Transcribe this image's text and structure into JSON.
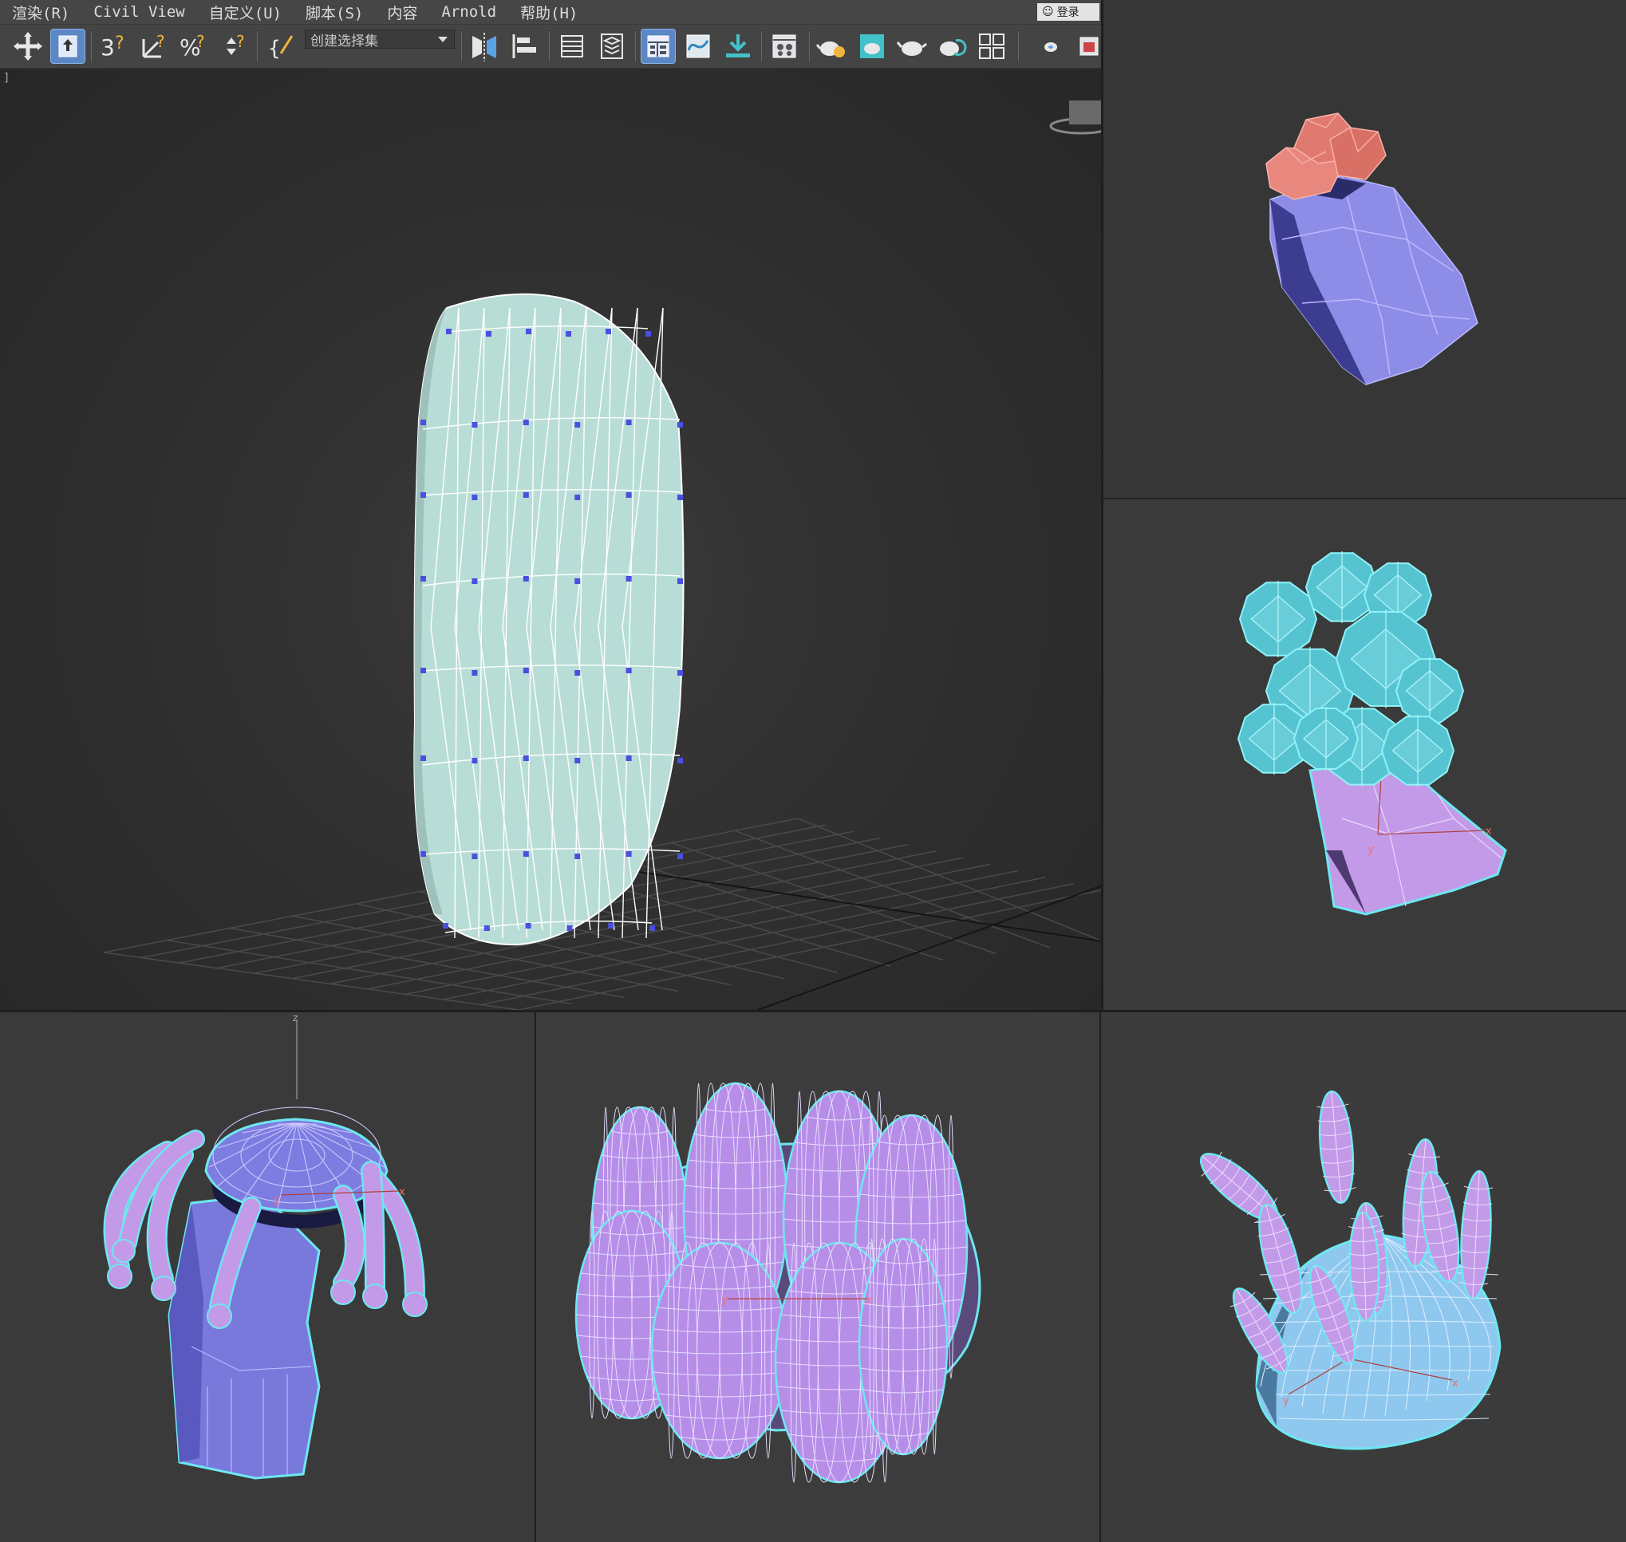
{
  "menu": {
    "items": [
      "渲染(R)",
      "Civil View",
      "自定义(U)",
      "脚本(S)",
      "内容",
      "Arnold",
      "帮助(H)"
    ],
    "login_label": "登录"
  },
  "toolbar": {
    "selection_set_placeholder": "创建选择集",
    "icons": [
      "move-icon",
      "select-region-icon",
      "snap-3d-icon",
      "angle-snap-icon",
      "percent-snap-icon",
      "spinner-snap-icon",
      "named-selection-icon",
      "mirror-icon",
      "align-icon",
      "scene-explorer-icon",
      "layer-explorer-icon",
      "ribbon-toggle-icon",
      "curve-editor-icon",
      "schematic-view-icon",
      "material-editor-icon",
      "render-setup-icon",
      "rendered-frame-icon",
      "render-icon",
      "render-iterative-icon",
      "render-cloud-icon",
      "render-gallery-icon",
      "teapot-icon",
      "frame-window-icon"
    ]
  },
  "viewports": {
    "main_label": "]",
    "main_object": "capsule-mesh-edit-poly",
    "top_right_object": "vase-with-flowers",
    "mid_right_object": "tree-with-cluster",
    "bottom_left_object": "mushroom-creature",
    "bottom_middle_object": "cactus-cluster",
    "bottom_right_object": "dome-with-spikes"
  },
  "axis_labels": {
    "x": "x",
    "y": "y",
    "z": "z"
  },
  "colors": {
    "capsule": "#c7ebe3",
    "vertex": "#4b4fe0",
    "vase": "#8e8ee8",
    "flower": "#e88a80",
    "tree_cluster": "#56c4d0",
    "trunk_purple": "#c39ae8",
    "mushroom": "#7d7ce0",
    "cactus": "#b68ee8",
    "dome": "#8fc8ee",
    "selection_outline": "#6ee7f0",
    "grid": "#4a4a4a"
  }
}
